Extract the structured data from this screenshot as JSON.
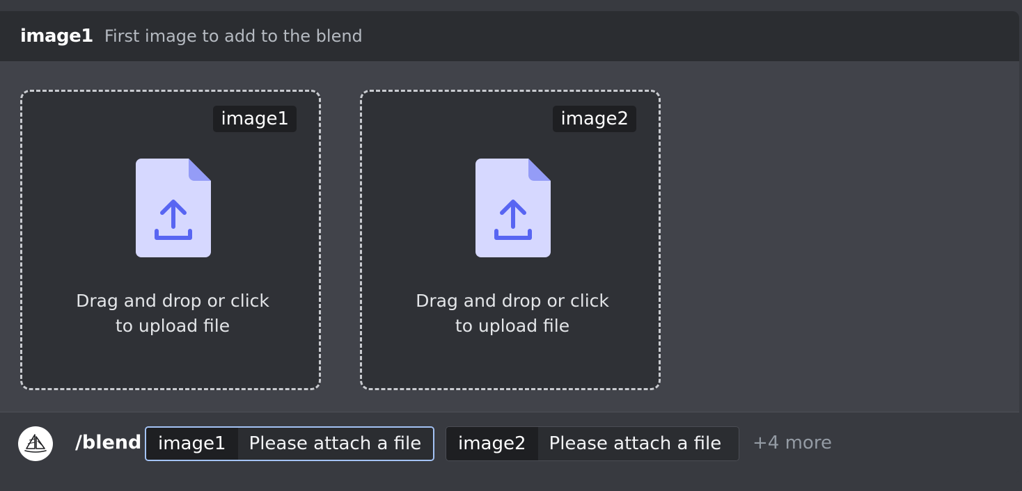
{
  "option_header": {
    "name": "image1",
    "description": "First image to add to the blend"
  },
  "dropzones": [
    {
      "tag": "image1",
      "instruction": "Drag and drop or click to upload file"
    },
    {
      "tag": "image2",
      "instruction": "Drag and drop or click to upload file"
    }
  ],
  "command_bar": {
    "command": "/blend",
    "options": [
      {
        "key": "image1",
        "value": "Please attach a file"
      },
      {
        "key": "image2",
        "value": "Please attach a file"
      }
    ],
    "more": "+4 more"
  },
  "colors": {
    "accent": "#5865f2",
    "file_icon_body": "#d6d8ff",
    "file_icon_fold": "#949cf7",
    "focus_border": "#a4c3f5"
  },
  "icons": {
    "file_upload": "file-upload-icon",
    "bot_avatar": "sailboat-icon"
  }
}
